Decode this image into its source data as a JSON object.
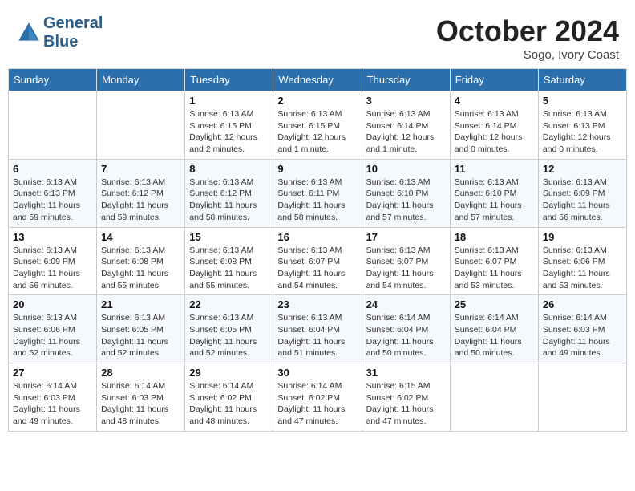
{
  "header": {
    "logo_line1": "General",
    "logo_line2": "Blue",
    "month": "October 2024",
    "location": "Sogo, Ivory Coast"
  },
  "weekdays": [
    "Sunday",
    "Monday",
    "Tuesday",
    "Wednesday",
    "Thursday",
    "Friday",
    "Saturday"
  ],
  "weeks": [
    [
      {
        "day": "",
        "info": ""
      },
      {
        "day": "",
        "info": ""
      },
      {
        "day": "1",
        "info": "Sunrise: 6:13 AM\nSunset: 6:15 PM\nDaylight: 12 hours\nand 2 minutes."
      },
      {
        "day": "2",
        "info": "Sunrise: 6:13 AM\nSunset: 6:15 PM\nDaylight: 12 hours\nand 1 minute."
      },
      {
        "day": "3",
        "info": "Sunrise: 6:13 AM\nSunset: 6:14 PM\nDaylight: 12 hours\nand 1 minute."
      },
      {
        "day": "4",
        "info": "Sunrise: 6:13 AM\nSunset: 6:14 PM\nDaylight: 12 hours\nand 0 minutes."
      },
      {
        "day": "5",
        "info": "Sunrise: 6:13 AM\nSunset: 6:13 PM\nDaylight: 12 hours\nand 0 minutes."
      }
    ],
    [
      {
        "day": "6",
        "info": "Sunrise: 6:13 AM\nSunset: 6:13 PM\nDaylight: 11 hours\nand 59 minutes."
      },
      {
        "day": "7",
        "info": "Sunrise: 6:13 AM\nSunset: 6:12 PM\nDaylight: 11 hours\nand 59 minutes."
      },
      {
        "day": "8",
        "info": "Sunrise: 6:13 AM\nSunset: 6:12 PM\nDaylight: 11 hours\nand 58 minutes."
      },
      {
        "day": "9",
        "info": "Sunrise: 6:13 AM\nSunset: 6:11 PM\nDaylight: 11 hours\nand 58 minutes."
      },
      {
        "day": "10",
        "info": "Sunrise: 6:13 AM\nSunset: 6:10 PM\nDaylight: 11 hours\nand 57 minutes."
      },
      {
        "day": "11",
        "info": "Sunrise: 6:13 AM\nSunset: 6:10 PM\nDaylight: 11 hours\nand 57 minutes."
      },
      {
        "day": "12",
        "info": "Sunrise: 6:13 AM\nSunset: 6:09 PM\nDaylight: 11 hours\nand 56 minutes."
      }
    ],
    [
      {
        "day": "13",
        "info": "Sunrise: 6:13 AM\nSunset: 6:09 PM\nDaylight: 11 hours\nand 56 minutes."
      },
      {
        "day": "14",
        "info": "Sunrise: 6:13 AM\nSunset: 6:08 PM\nDaylight: 11 hours\nand 55 minutes."
      },
      {
        "day": "15",
        "info": "Sunrise: 6:13 AM\nSunset: 6:08 PM\nDaylight: 11 hours\nand 55 minutes."
      },
      {
        "day": "16",
        "info": "Sunrise: 6:13 AM\nSunset: 6:07 PM\nDaylight: 11 hours\nand 54 minutes."
      },
      {
        "day": "17",
        "info": "Sunrise: 6:13 AM\nSunset: 6:07 PM\nDaylight: 11 hours\nand 54 minutes."
      },
      {
        "day": "18",
        "info": "Sunrise: 6:13 AM\nSunset: 6:07 PM\nDaylight: 11 hours\nand 53 minutes."
      },
      {
        "day": "19",
        "info": "Sunrise: 6:13 AM\nSunset: 6:06 PM\nDaylight: 11 hours\nand 53 minutes."
      }
    ],
    [
      {
        "day": "20",
        "info": "Sunrise: 6:13 AM\nSunset: 6:06 PM\nDaylight: 11 hours\nand 52 minutes."
      },
      {
        "day": "21",
        "info": "Sunrise: 6:13 AM\nSunset: 6:05 PM\nDaylight: 11 hours\nand 52 minutes."
      },
      {
        "day": "22",
        "info": "Sunrise: 6:13 AM\nSunset: 6:05 PM\nDaylight: 11 hours\nand 52 minutes."
      },
      {
        "day": "23",
        "info": "Sunrise: 6:13 AM\nSunset: 6:04 PM\nDaylight: 11 hours\nand 51 minutes."
      },
      {
        "day": "24",
        "info": "Sunrise: 6:14 AM\nSunset: 6:04 PM\nDaylight: 11 hours\nand 50 minutes."
      },
      {
        "day": "25",
        "info": "Sunrise: 6:14 AM\nSunset: 6:04 PM\nDaylight: 11 hours\nand 50 minutes."
      },
      {
        "day": "26",
        "info": "Sunrise: 6:14 AM\nSunset: 6:03 PM\nDaylight: 11 hours\nand 49 minutes."
      }
    ],
    [
      {
        "day": "27",
        "info": "Sunrise: 6:14 AM\nSunset: 6:03 PM\nDaylight: 11 hours\nand 49 minutes."
      },
      {
        "day": "28",
        "info": "Sunrise: 6:14 AM\nSunset: 6:03 PM\nDaylight: 11 hours\nand 48 minutes."
      },
      {
        "day": "29",
        "info": "Sunrise: 6:14 AM\nSunset: 6:02 PM\nDaylight: 11 hours\nand 48 minutes."
      },
      {
        "day": "30",
        "info": "Sunrise: 6:14 AM\nSunset: 6:02 PM\nDaylight: 11 hours\nand 47 minutes."
      },
      {
        "day": "31",
        "info": "Sunrise: 6:15 AM\nSunset: 6:02 PM\nDaylight: 11 hours\nand 47 minutes."
      },
      {
        "day": "",
        "info": ""
      },
      {
        "day": "",
        "info": ""
      }
    ]
  ]
}
